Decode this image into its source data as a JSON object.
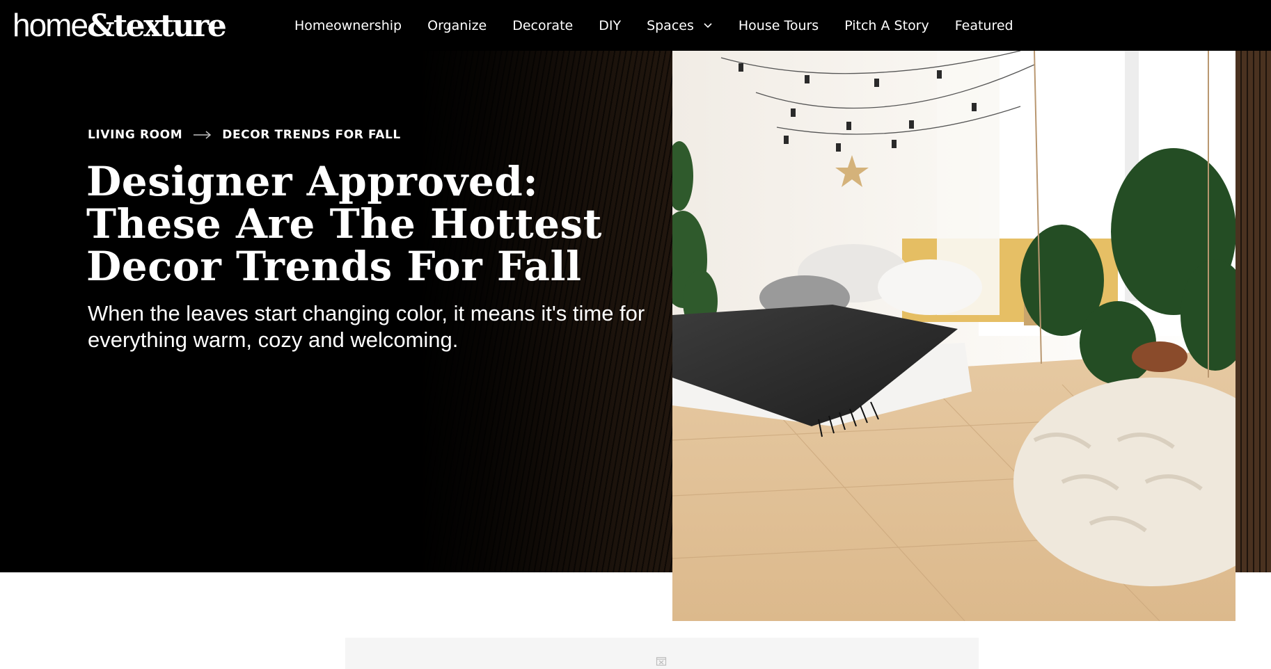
{
  "site": {
    "logo_part1": "home",
    "logo_part2": "&",
    "logo_part3": "texture"
  },
  "nav": {
    "items": [
      {
        "label": "Homeownership"
      },
      {
        "label": "Organize"
      },
      {
        "label": "Decorate"
      },
      {
        "label": "DIY"
      },
      {
        "label": "Spaces",
        "has_dropdown": true
      },
      {
        "label": "House Tours"
      },
      {
        "label": "Pitch A Story"
      },
      {
        "label": "Featured"
      }
    ]
  },
  "article": {
    "breadcrumb": [
      "LIVING ROOM",
      "DECOR TRENDS FOR FALL"
    ],
    "title": "Designer Approved: These Are The Hottest Decor Trends For Fall",
    "dek": "When the leaves start changing color, it means it's time for everything warm, cozy and welcoming."
  },
  "colors": {
    "nav_bg": "#000000",
    "hero_bg": "#000000",
    "text": "#ffffff",
    "ad_bg": "#f5f5f5"
  },
  "icons": {
    "dropdown": "chevron-down-icon",
    "breadcrumb_sep": "arrow-right-icon",
    "ad": "image-placeholder-icon"
  }
}
